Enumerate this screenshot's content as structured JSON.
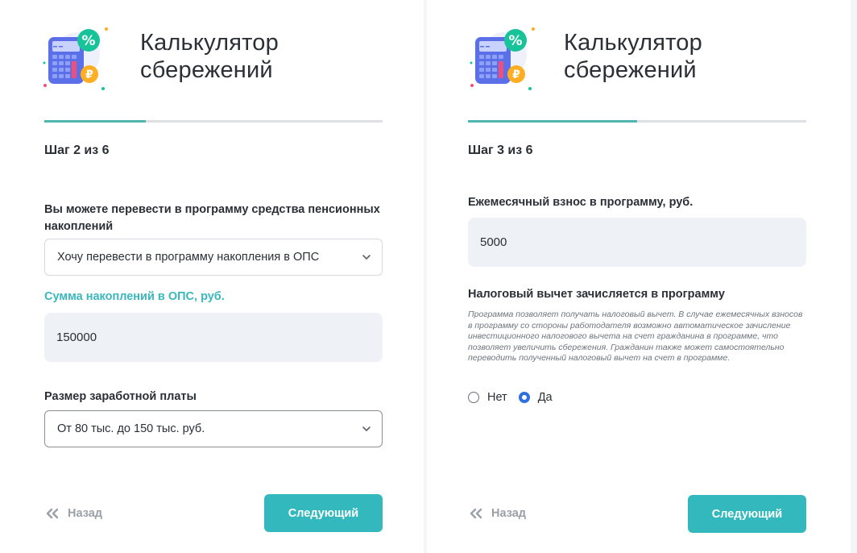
{
  "colors": {
    "accent": "#33b9bd",
    "progress": "#4fb5b1",
    "radio_checked": "#2f6fe0"
  },
  "icons": {
    "logo": "calculator-percent-ruble-icon",
    "chevron": "chevron-down-icon",
    "back": "double-chevron-left-icon"
  },
  "left": {
    "title": "Калькулятор сбережений",
    "progress": 0.3,
    "step": "Шаг 2 из 6",
    "transfer_label": "Вы можете перевести в программу средства пенсионных накоплений",
    "transfer_select": "Хочу перевести в программу накопления в ОПС",
    "savings_label": "Сумма накоплений в ОПС, руб.",
    "savings_value": "150000",
    "salary_label": "Размер заработной платы",
    "salary_select": "От 80 тыс. до 150 тыс. руб.",
    "back_label": "Назад",
    "next_label": "Следующий"
  },
  "right": {
    "title": "Калькулятор сбережений",
    "progress": 0.5,
    "step": "Шаг 3 из 6",
    "monthly_label": "Ежемесячный взнос в программу, руб.",
    "monthly_value": "5000",
    "tax_label": "Налоговый вычет зачисляется в программу",
    "tax_hint": "Программа позволяет получать налоговый вычет. В случае ежемесячных взносов в программу со стороны работодателя возможно автоматическое зачисление инвестиционного налогового вычета на счет гражданина в программе, что позволяет увеличить сбережения. Гражданин также может самостоятельно переводить полученный налоговый вычет на счет в программе.",
    "options": [
      {
        "label": "Нет",
        "checked": false
      },
      {
        "label": "Да",
        "checked": true
      }
    ],
    "back_label": "Назад",
    "next_label": "Следующий"
  }
}
